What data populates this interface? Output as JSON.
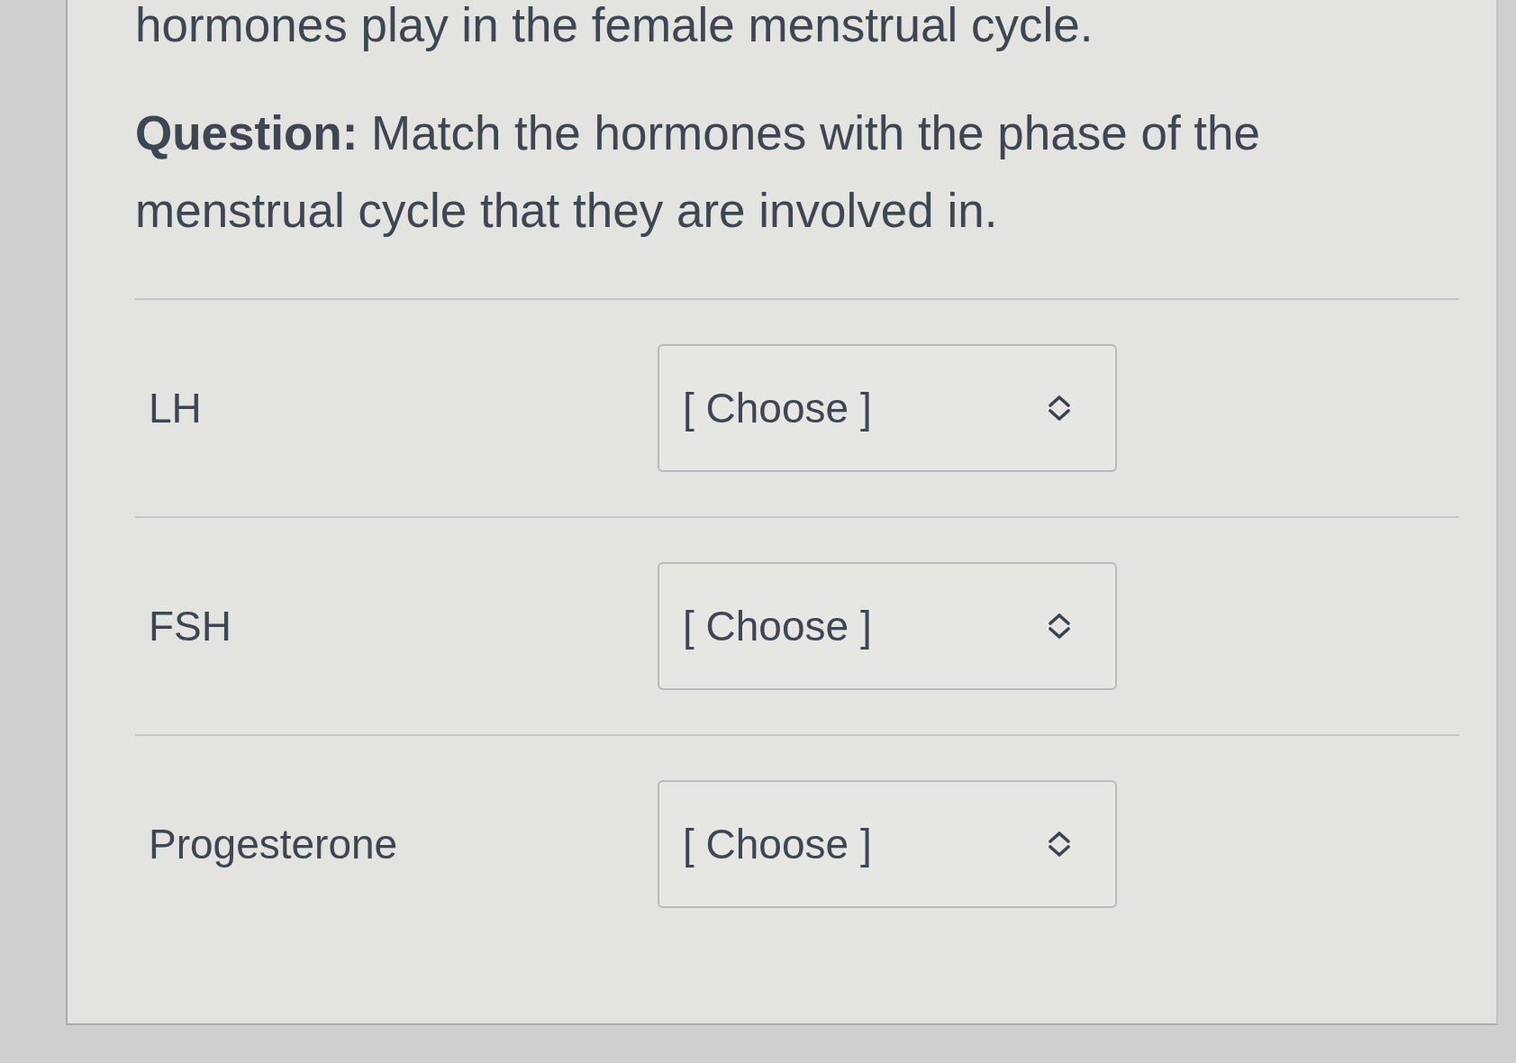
{
  "intro_text": "hormones play in the female menstrual cycle.",
  "question": "**Question:** Match the hormones with the phase of the menstrual cycle that they are involved in.",
  "matches": [
    {
      "term": "LH",
      "dropdown": {
        "value": "[ Choose ]"
      }
    },
    {
      "term": "FSH",
      "dropdown": {
        "value": "[ Choose ]"
      }
    },
    {
      "term": "Progesterone",
      "dropdown": {
        "value": "[ Choose ]"
      }
    }
  ]
}
